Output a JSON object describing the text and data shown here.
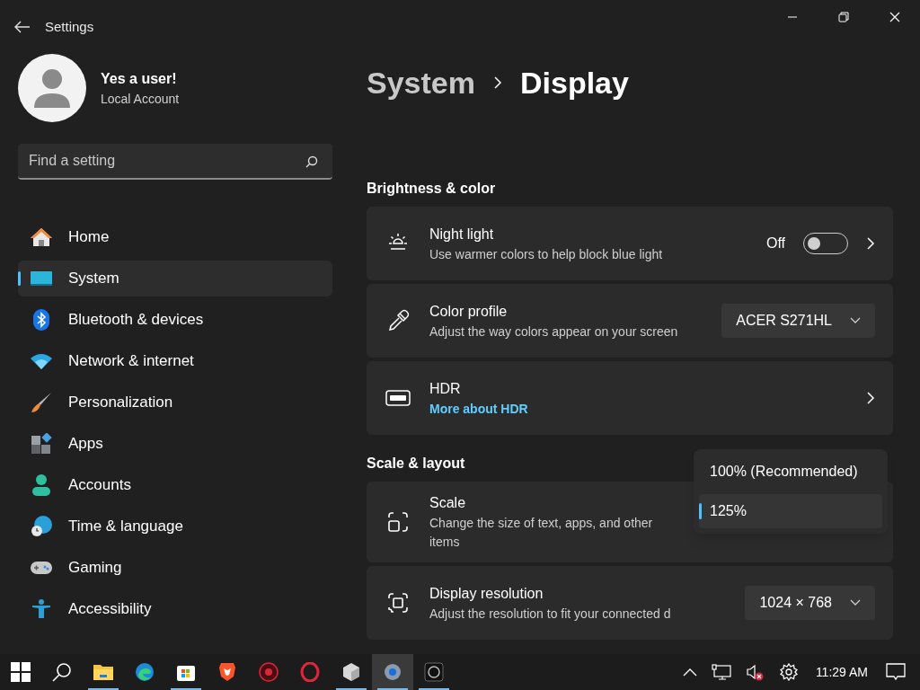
{
  "window": {
    "title": "Settings"
  },
  "user": {
    "name": "Yes a user!",
    "account": "Local Account"
  },
  "search": {
    "placeholder": "Find a setting"
  },
  "nav": [
    {
      "label": "Home",
      "selected": false
    },
    {
      "label": "System",
      "selected": true
    },
    {
      "label": "Bluetooth & devices",
      "selected": false
    },
    {
      "label": "Network & internet",
      "selected": false
    },
    {
      "label": "Personalization",
      "selected": false
    },
    {
      "label": "Apps",
      "selected": false
    },
    {
      "label": "Accounts",
      "selected": false
    },
    {
      "label": "Time & language",
      "selected": false
    },
    {
      "label": "Gaming",
      "selected": false
    },
    {
      "label": "Accessibility",
      "selected": false
    }
  ],
  "breadcrumb": {
    "parent": "System",
    "current": "Display"
  },
  "sections": [
    {
      "title": "Brightness & color",
      "rows": [
        {
          "kind": "toggle",
          "title": "Night light",
          "subtitle": "Use warmer colors to help block blue light",
          "state_label": "Off",
          "on": false
        },
        {
          "kind": "dropdown",
          "title": "Color profile",
          "subtitle": "Adjust the way colors appear on your screen",
          "value": "ACER S271HL"
        },
        {
          "kind": "link",
          "title": "HDR",
          "link": "More about HDR"
        }
      ]
    },
    {
      "title": "Scale & layout",
      "rows": [
        {
          "kind": "menu",
          "title": "Scale",
          "subtitle": "Change the size of text, apps, and other items",
          "options": [
            {
              "label": "100% (Recommended)",
              "selected": false
            },
            {
              "label": "125%",
              "selected": true
            }
          ]
        },
        {
          "kind": "dropdown",
          "title": "Display resolution",
          "subtitle": "Adjust the resolution to fit your connected d",
          "value": "1024 × 768"
        }
      ]
    }
  ],
  "taskbar": {
    "apps": [
      {
        "running": false,
        "selected": false
      },
      {
        "running": false,
        "selected": false
      },
      {
        "running": true,
        "selected": false
      },
      {
        "running": false,
        "selected": false
      },
      {
        "running": true,
        "selected": false
      },
      {
        "running": false,
        "selected": false
      },
      {
        "running": false,
        "selected": false
      },
      {
        "running": false,
        "selected": false
      },
      {
        "running": true,
        "selected": false
      },
      {
        "running": true,
        "selected": true
      },
      {
        "running": true,
        "selected": false
      }
    ],
    "clock": "11:29 AM"
  }
}
